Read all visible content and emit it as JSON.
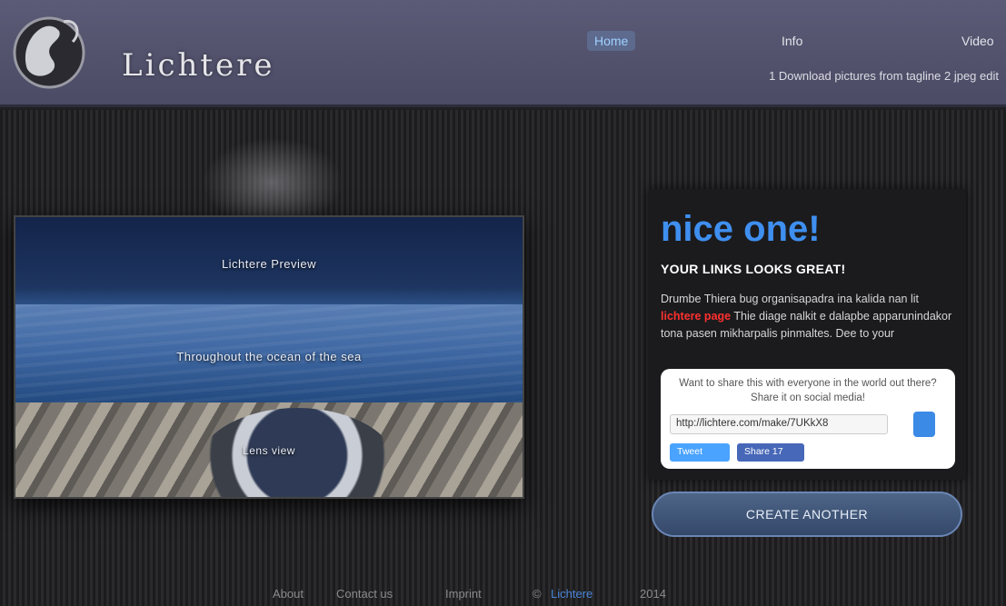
{
  "header": {
    "brand": "Lichtere",
    "nav": [
      {
        "label": "Home",
        "active": true
      },
      {
        "label": "Info",
        "active": false
      },
      {
        "label": "Video",
        "active": false
      }
    ],
    "tagline": "1 Download pictures from tagline 2 jpeg edit"
  },
  "showcase": {
    "captions": [
      "Lichtere Preview",
      "Throughout the ocean of the sea",
      "Lens view"
    ]
  },
  "card": {
    "title": "nice one!",
    "subtitle": "YOUR LINKS LOOKS GREAT!",
    "body_before": "Drumbe Thiera bug organisapadra ina kalida nan lit",
    "body_highlight": "lichtere page",
    "body_after": "Thie diage nalkit e dalapbe apparunindakor tona pasen mikharpalis pinmaltes. Dee to your",
    "share_prompt": "Want to share this with everyone in the world out there? Share it on social media!",
    "share_url": "http://lichtere.com/make/7UKkX8",
    "share_buttons": [
      "Tweet",
      "Share 17"
    ]
  },
  "cta": {
    "label": "CREATE ANOTHER"
  },
  "footer": {
    "items": [
      "About",
      "Contact us",
      "Imprint",
      "©",
      "Lichtere",
      "2014"
    ]
  },
  "colors": {
    "accent": "#3f8ff0",
    "highlight": "#ff3030",
    "header_bg": "#55556f"
  }
}
